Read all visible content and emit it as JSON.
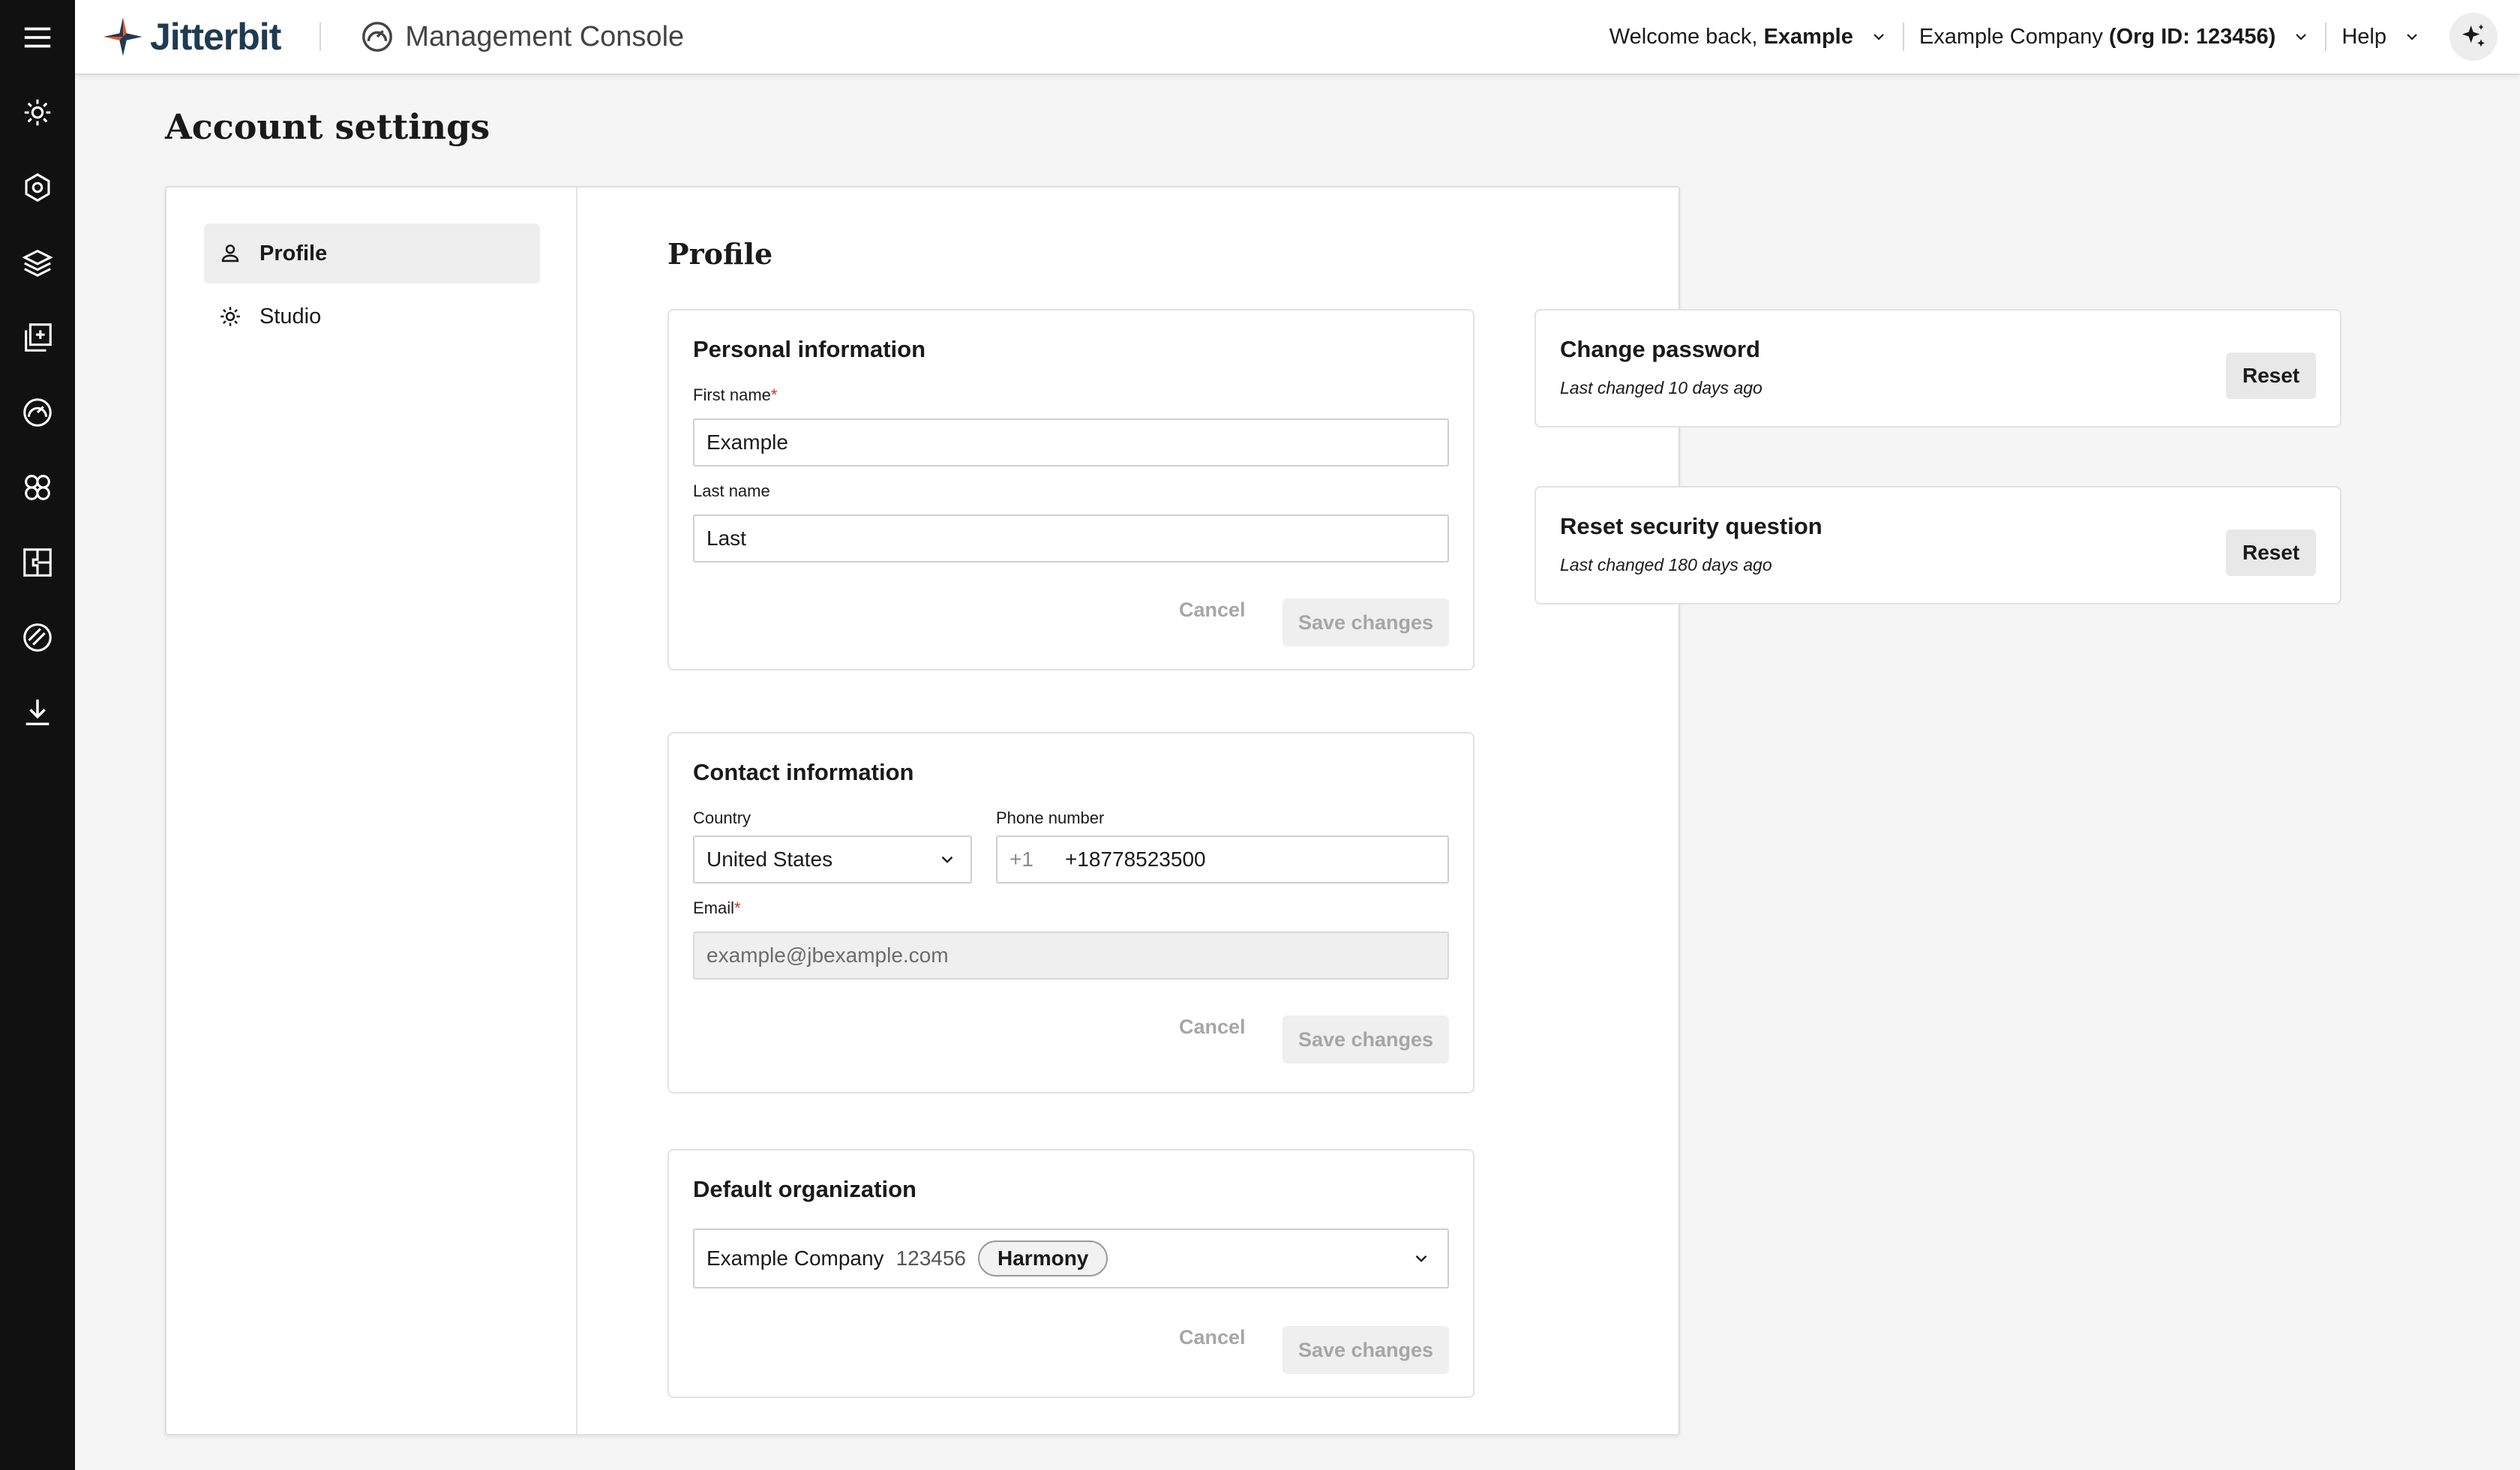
{
  "brand": {
    "name": "Jitterbit",
    "accent": "#e8562a",
    "dark": "#1f3a52"
  },
  "header": {
    "console_title": "Management Console",
    "welcome_prefix": "Welcome back,",
    "user_name": "Example",
    "company": "Example Company",
    "org_id": "(Org ID: 123456)",
    "help": "Help"
  },
  "rail": {
    "icons": [
      "menu-icon",
      "cog-icon",
      "gear-hex-icon",
      "layers-icon",
      "add-copy-icon",
      "dashboard-gauge-icon",
      "nodes-icon",
      "puzzle-icon",
      "slash-circle-icon",
      "download-icon"
    ]
  },
  "page": {
    "title": "Account settings"
  },
  "nav": {
    "items": [
      {
        "label": "Profile",
        "icon": "user-icon"
      },
      {
        "label": "Studio",
        "icon": "cog-icon"
      }
    ]
  },
  "profile": {
    "section_title": "Profile",
    "personal": {
      "title": "Personal information",
      "first_name_label": "First name",
      "first_name_value": "Example",
      "last_name_label": "Last name",
      "last_name_value": "Last",
      "cancel": "Cancel",
      "save": "Save changes"
    },
    "contact": {
      "title": "Contact information",
      "country_label": "Country",
      "country_value": "United States",
      "phone_label": "Phone number",
      "phone_prefix": "+1",
      "phone_value": "+18778523500",
      "email_label": "Email",
      "email_value": "example@jbexample.com",
      "cancel": "Cancel",
      "save": "Save changes"
    },
    "default_org": {
      "title": "Default organization",
      "company": "Example Company",
      "org_number": "123456",
      "badge": "Harmony",
      "cancel": "Cancel",
      "save": "Save changes"
    },
    "password": {
      "title": "Change password",
      "note": "Last changed 10 days ago",
      "button": "Reset"
    },
    "security": {
      "title": "Reset security question",
      "note": "Last changed 180 days ago",
      "button": "Reset"
    }
  },
  "required_marker": "*"
}
